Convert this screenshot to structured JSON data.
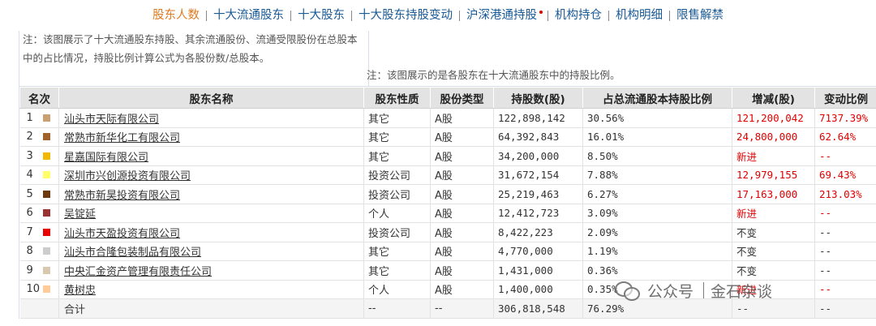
{
  "nav": {
    "items": [
      {
        "label": "股东人数",
        "active": true
      },
      {
        "label": "十大流通股东",
        "active": false
      },
      {
        "label": "十大股东",
        "active": false
      },
      {
        "label": "十大股东持股变动",
        "active": false
      },
      {
        "label": "沪深港通持股",
        "active": false,
        "dot": true
      },
      {
        "label": "机构持仓",
        "active": false
      },
      {
        "label": "机构明细",
        "active": false
      },
      {
        "label": "限售解禁",
        "active": false
      }
    ]
  },
  "notes": {
    "left": "注：该图展示了十大流通股东持股、其余流通股份、流通受限股份在总股本中的占比情况，持股比例计算公式为各股份数/总股本。",
    "right": "注：该图展示的是各股东在十大流通股东中的持股比例。"
  },
  "table": {
    "headers": [
      "名次",
      "股东名称",
      "股东性质",
      "股份类型",
      "持股数(股)",
      "占总流通股本持股比例",
      "增减(股)",
      "变动比例"
    ],
    "rows": [
      {
        "rank": "1",
        "color": "#c8a072",
        "name": "汕头市天际有限公司",
        "nature": "其它",
        "type": "A股",
        "shares": "122,898,142",
        "ratio": "30.56%",
        "change": "121,200,042",
        "change_pct": "7137.39%",
        "red": true
      },
      {
        "rank": "2",
        "color": "#a0622a",
        "name": "常熟市新华化工有限公司",
        "nature": "其它",
        "type": "A股",
        "shares": "64,392,843",
        "ratio": "16.01%",
        "change": "24,800,000",
        "change_pct": "62.64%",
        "red": true
      },
      {
        "rank": "3",
        "color": "#f0b800",
        "name": "星嘉国际有限公司",
        "nature": "其它",
        "type": "A股",
        "shares": "34,200,000",
        "ratio": "8.50%",
        "change": "新进",
        "change_pct": "--",
        "red": true
      },
      {
        "rank": "4",
        "color": "#ffff66",
        "name": "深圳市兴创源投资有限公司",
        "nature": "投资公司",
        "type": "A股",
        "shares": "31,672,154",
        "ratio": "7.88%",
        "change": "12,979,155",
        "change_pct": "69.43%",
        "red": true
      },
      {
        "rank": "5",
        "color": "#6b3a10",
        "name": "常熟市新昊投资有限公司",
        "nature": "投资公司",
        "type": "A股",
        "shares": "25,219,463",
        "ratio": "6.27%",
        "change": "17,163,000",
        "change_pct": "213.03%",
        "red": true
      },
      {
        "rank": "6",
        "color": "#993333",
        "name": "吴锭延",
        "nature": "个人",
        "type": "A股",
        "shares": "12,412,723",
        "ratio": "3.09%",
        "change": "新进",
        "change_pct": "--",
        "red": true
      },
      {
        "rank": "7",
        "color": "#e60000",
        "name": "汕头市天盈投资有限公司",
        "nature": "投资公司",
        "type": "A股",
        "shares": "8,422,223",
        "ratio": "2.09%",
        "change": "不变",
        "change_pct": "--",
        "red": false
      },
      {
        "rank": "8",
        "color": "#cccccc",
        "name": "汕头市合隆包装制品有限公司",
        "nature": "其它",
        "type": "A股",
        "shares": "4,770,000",
        "ratio": "1.19%",
        "change": "不变",
        "change_pct": "--",
        "red": false
      },
      {
        "rank": "9",
        "color": "#d8c8b0",
        "name": "中央汇金资产管理有限责任公司",
        "nature": "其它",
        "type": "A股",
        "shares": "1,431,000",
        "ratio": "0.36%",
        "change": "不变",
        "change_pct": "--",
        "red": false
      },
      {
        "rank": "10",
        "color": "#ffcc99",
        "name": "黄树忠",
        "nature": "个人",
        "type": "A股",
        "shares": "1,400,000",
        "ratio": "0.35%",
        "change": "新进",
        "change_pct": "--",
        "red": true
      }
    ],
    "total": {
      "label": "合计",
      "nature": "--",
      "type": "--",
      "shares": "306,818,548",
      "ratio": "76.29%",
      "change": "--",
      "change_pct": "--"
    }
  },
  "watermark": {
    "text1": "公众号",
    "text2": "金石杂谈",
    "icon": "wechat-icon"
  }
}
